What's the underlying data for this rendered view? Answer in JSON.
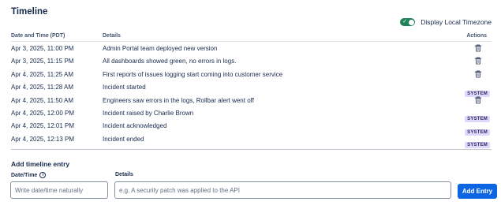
{
  "header": {
    "title": "Timeline",
    "toggle_label": "Display Local Timezone",
    "toggle_on": true
  },
  "table": {
    "columns": {
      "date": "Date and Time (PDT)",
      "details": "Details",
      "actions": "Actions"
    },
    "rows": [
      {
        "date": "Apr 3, 2025, 11:00 PM",
        "details": "Admin Portal team deployed new version",
        "action": "trash-icon"
      },
      {
        "date": "Apr 3, 2025, 11:15 PM",
        "details": "All dashboards showed green, no errors in logs.",
        "action": "trash-icon"
      },
      {
        "date": "Apr 4, 2025, 11:25 AM",
        "details": "First reports of issues logging start coming into customer service",
        "action": "trash-icon"
      },
      {
        "date": "Apr 4, 2025, 11:28 AM",
        "details": "Incident started",
        "action": "SYSTEM"
      },
      {
        "date": "Apr 4, 2025, 11:50 AM",
        "details": "Engineers saw errors in the logs, Rollbar alert went off",
        "action": "trash-icon"
      },
      {
        "date": "Apr 4, 2025, 12:00 PM",
        "details": "Incident raised by Charlie Brown",
        "action": "SYSTEM"
      },
      {
        "date": "Apr 4, 2025, 12:01 PM",
        "details": "Incident acknowledged",
        "action": "SYSTEM"
      },
      {
        "date": "Apr 4, 2025, 12:13 PM",
        "details": "Incident ended",
        "action": "SYSTEM"
      }
    ]
  },
  "add_entry": {
    "title": "Add timeline entry",
    "date_label": "Date/Time",
    "date_info_icon": "info-icon",
    "date_placeholder": "Write date/time naturally",
    "details_label": "Details",
    "details_placeholder": "e.g. A security patch was applied to the API",
    "button_label": "Add Entry"
  },
  "colors": {
    "toggle_on": "#1f845a",
    "primary_button": "#0c66e4",
    "system_badge_bg": "#dfd8fd",
    "system_badge_text": "#352c63"
  }
}
